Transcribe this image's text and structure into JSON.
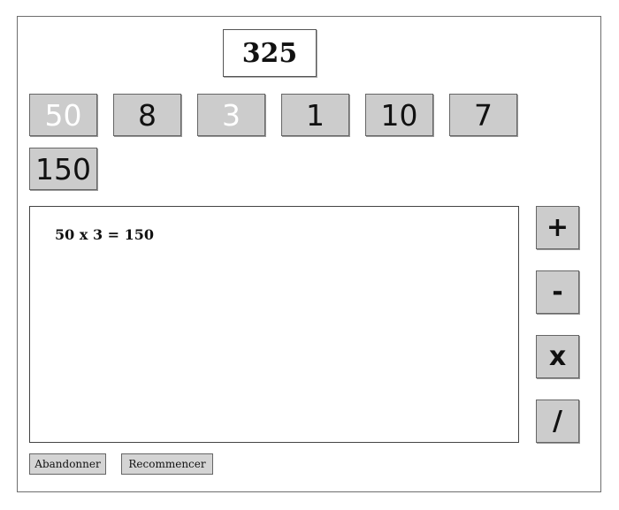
{
  "target": {
    "value": "325"
  },
  "tiles": [
    {
      "label": "50",
      "used": true
    },
    {
      "label": "8",
      "used": false
    },
    {
      "label": "3",
      "used": true
    },
    {
      "label": "1",
      "used": false
    },
    {
      "label": "10",
      "used": false
    },
    {
      "label": "7",
      "used": false
    },
    {
      "label": "150",
      "used": false
    }
  ],
  "log": {
    "lines": [
      "50 x 3 = 150"
    ]
  },
  "operators": {
    "add": "+",
    "subtract": "-",
    "multiply": "x",
    "divide": "/"
  },
  "buttons": {
    "abandon_label": "Abandonner",
    "restart_label": "Recommencer"
  },
  "colors": {
    "tile_bg": "#cccccc",
    "used_text": "#ffffff",
    "text": "#111111"
  }
}
